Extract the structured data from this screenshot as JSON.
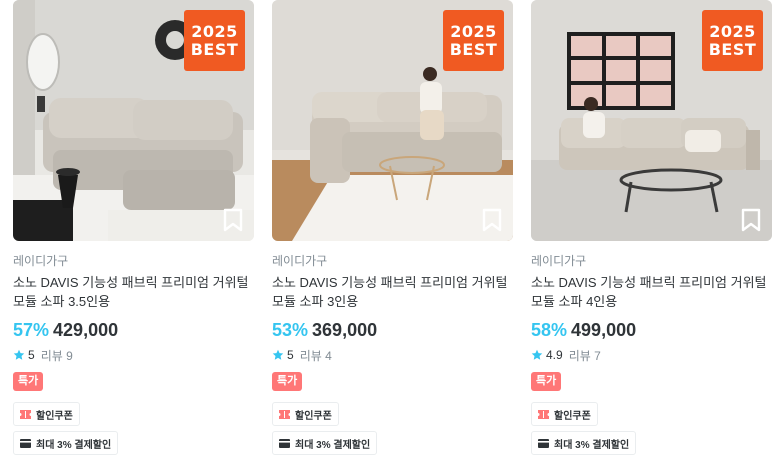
{
  "products": [
    {
      "badge_line1": "2025",
      "badge_line2": "BEST",
      "brand": "레이디가구",
      "title": "소노 DAVIS 기능성 패브릭 프리미엄 거위털 모듈 소파 3.5인용",
      "discount": "57%",
      "price": "429,000",
      "rating": "5",
      "review_label": "리뷰 9",
      "special_label": "특가",
      "coupon_label": "할인쿠폰",
      "payment_label": "최대 3% 결제할인",
      "icons": {
        "bookmark": "bookmark-icon",
        "star": "star-icon",
        "coupon": "coupon-icon",
        "card": "card-icon"
      }
    },
    {
      "badge_line1": "2025",
      "badge_line2": "BEST",
      "brand": "레이디가구",
      "title": "소노 DAVIS 기능성 패브릭 프리미엄 거위털 모듈 소파 3인용",
      "discount": "53%",
      "price": "369,000",
      "rating": "5",
      "review_label": "리뷰 4",
      "special_label": "특가",
      "coupon_label": "할인쿠폰",
      "payment_label": "최대 3% 결제할인",
      "icons": {
        "bookmark": "bookmark-icon",
        "star": "star-icon",
        "coupon": "coupon-icon",
        "card": "card-icon"
      }
    },
    {
      "badge_line1": "2025",
      "badge_line2": "BEST",
      "brand": "레이디가구",
      "title": "소노 DAVIS 기능성 패브릭 프리미엄 거위털 모듈 소파 4인용",
      "discount": "58%",
      "price": "499,000",
      "rating": "4.9",
      "review_label": "리뷰 7",
      "special_label": "특가",
      "coupon_label": "할인쿠폰",
      "payment_label": "최대 3% 결제할인",
      "icons": {
        "bookmark": "bookmark-icon",
        "star": "star-icon",
        "coupon": "coupon-icon",
        "card": "card-icon"
      }
    }
  ],
  "colors": {
    "accent": "#35c5f0",
    "badge": "#f05a22",
    "special": "#ff7777"
  }
}
